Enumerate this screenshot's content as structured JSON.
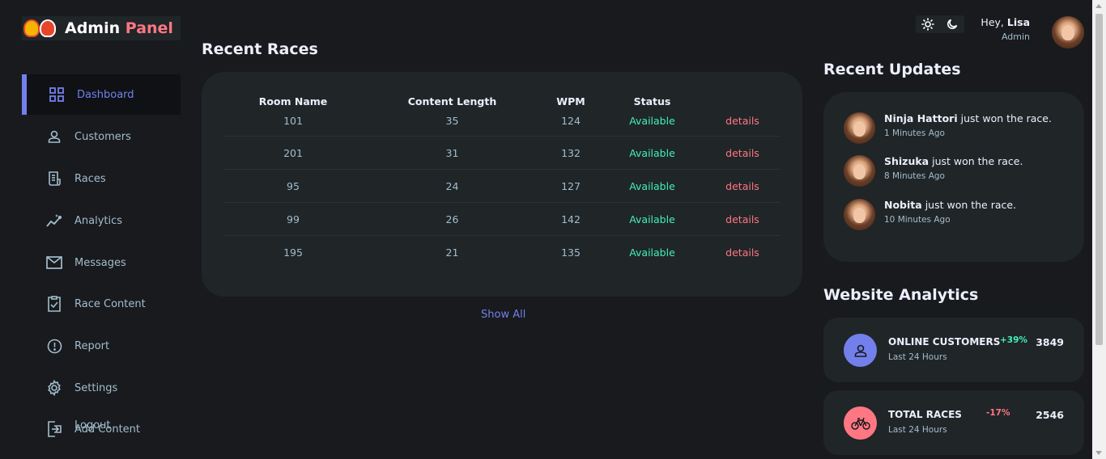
{
  "brand": {
    "name_part1": "Admin",
    "name_part2": "Panel"
  },
  "sidebar": {
    "items": [
      {
        "label": "Dashboard",
        "icon": "grid-icon",
        "active": true
      },
      {
        "label": "Customers",
        "icon": "user-icon"
      },
      {
        "label": "Races",
        "icon": "receipt-icon"
      },
      {
        "label": "Analytics",
        "icon": "insights-icon"
      },
      {
        "label": "Messages",
        "icon": "mail-icon"
      },
      {
        "label": "Race Content",
        "icon": "clipboard-check-icon"
      },
      {
        "label": "Report",
        "icon": "report-icon"
      },
      {
        "label": "Settings",
        "icon": "gear-icon"
      },
      {
        "label": "Logout",
        "icon": "logout-icon"
      },
      {
        "label": "Add Content"
      }
    ]
  },
  "main": {
    "title": "Recent Races",
    "table": {
      "headers": [
        "Room Name",
        "Content Length",
        "WPM",
        "Status",
        ""
      ],
      "rows": [
        [
          "101",
          "35",
          "124",
          "Available",
          "details"
        ],
        [
          "201",
          "31",
          "132",
          "Available",
          "details"
        ],
        [
          "95",
          "24",
          "127",
          "Available",
          "details"
        ],
        [
          "99",
          "26",
          "142",
          "Available",
          "details"
        ],
        [
          "195",
          "21",
          "135",
          "Available",
          "details"
        ]
      ]
    },
    "show_all": "Show All"
  },
  "header": {
    "theme_icons": [
      "sun-icon",
      "moon-icon"
    ],
    "greeting": "Hey,",
    "user_name": "Lisa",
    "role": "Admin"
  },
  "updates": {
    "title": "Recent Updates",
    "items": [
      {
        "name": "Ninja Hattori",
        "text": "just won the race.",
        "time": "1 Minutes Ago"
      },
      {
        "name": "Shizuka",
        "text": "just won the race.",
        "time": "8 Minutes Ago"
      },
      {
        "name": "Nobita",
        "text": "just won the race.",
        "time": "10 Minutes Ago"
      }
    ]
  },
  "analytics": {
    "title": "Website Analytics",
    "cards": [
      {
        "title": "ONLINE CUSTOMERS",
        "subtitle": "Last 24 Hours",
        "change": "+39%",
        "value": "3849",
        "color": "#7380ec",
        "change_color": "#41f1b6",
        "icon": "person-icon"
      },
      {
        "title": "TOTAL RACES",
        "subtitle": "Last 24 Hours",
        "change": "-17%",
        "value": "2546",
        "color": "#ff7782",
        "change_color": "#ff7782",
        "icon": "bicycle-icon"
      }
    ]
  },
  "colors": {
    "primary": "#7380ec",
    "danger": "#ff7782",
    "success": "#41f1b6",
    "background": "#181a1e",
    "card": "#202528"
  }
}
